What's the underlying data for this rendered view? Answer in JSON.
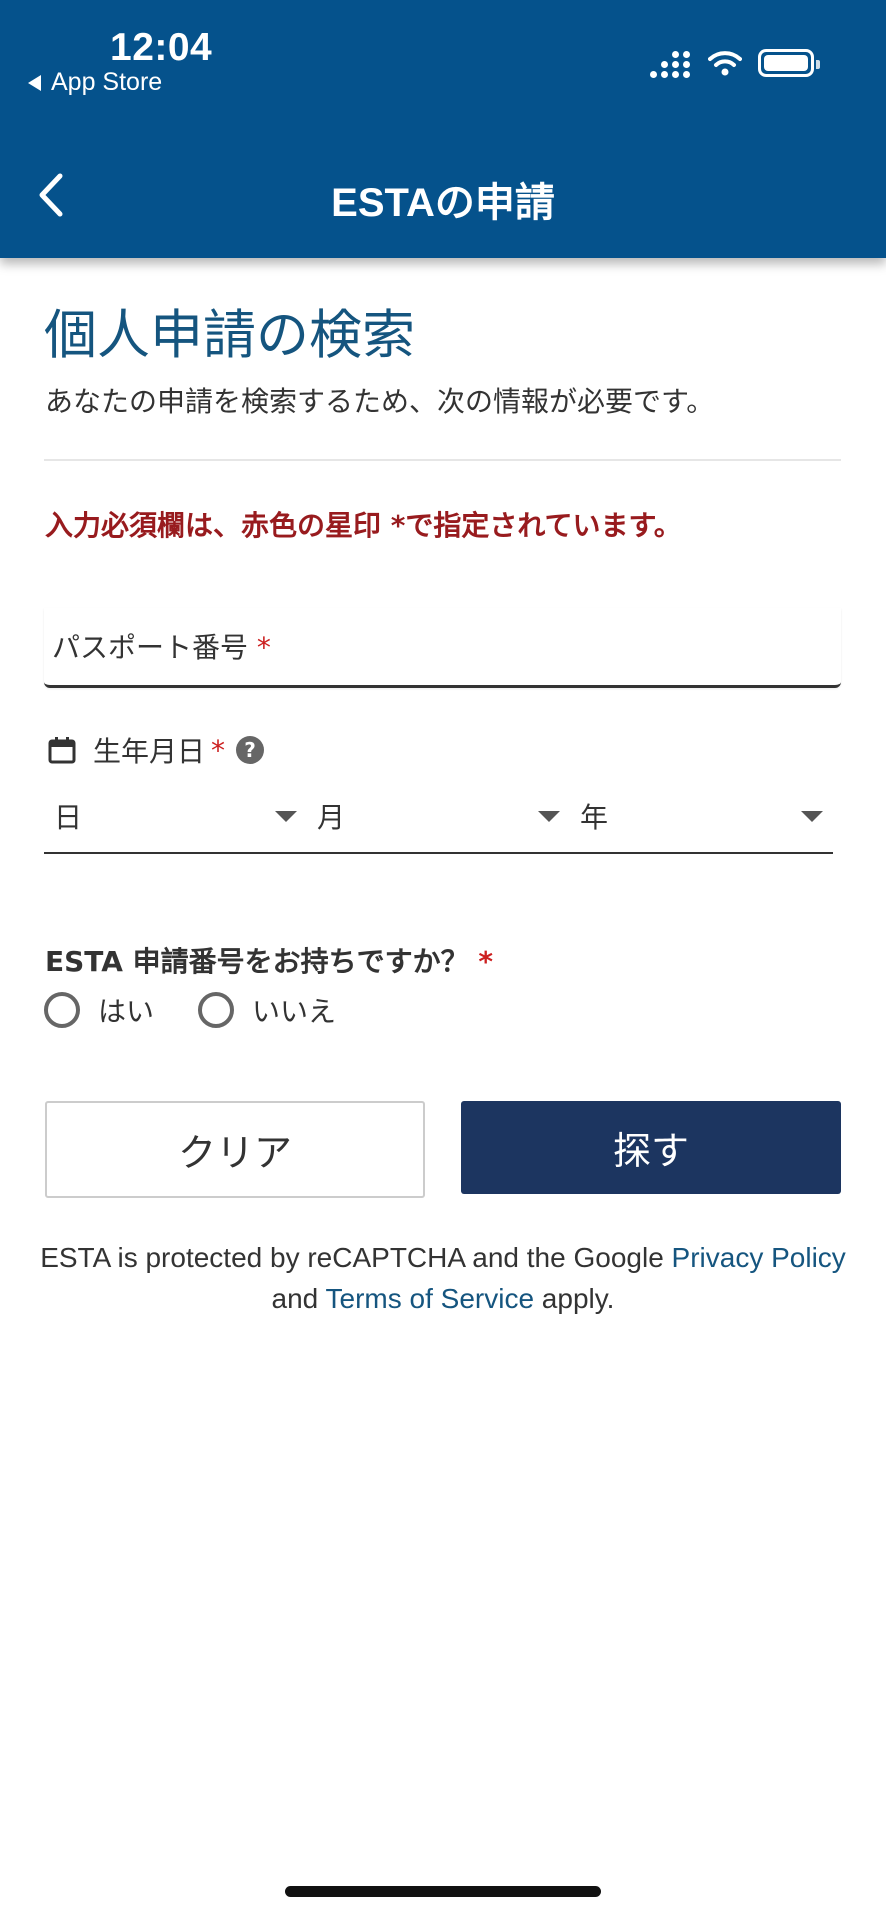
{
  "status_bar": {
    "time": "12:04",
    "back_app": "App Store",
    "icons": [
      "signal-icon",
      "wifi-icon",
      "battery-icon"
    ]
  },
  "nav": {
    "back_icon": "chevron-left-icon",
    "title": "ESTAの申請"
  },
  "main": {
    "title": "個人申請の検索",
    "subtitle": "あなたの申請を検索するため、次の情報が必要です。",
    "required_note": "入力必須欄は、赤色の星印 *で指定されています。",
    "passport": {
      "label": "パスポート番号",
      "required_mark": "*"
    },
    "dob": {
      "label": "生年月日",
      "required_mark": "*",
      "icon": "calendar-icon",
      "help_icon": "help-icon",
      "day": "日",
      "month": "月",
      "year": "年"
    },
    "question": {
      "label": "ESTA 申請番号をお持ちですか？",
      "required_mark": "*"
    },
    "radio": {
      "yes": "はい",
      "no": "いいえ"
    },
    "buttons": {
      "clear": "クリア",
      "search": "探す"
    },
    "recaptcha": {
      "prefix": "ESTA is protected by reCAPTCHA and the Google ",
      "privacy": "Privacy Policy",
      "and": "and ",
      "terms": "Terms of Service",
      "suffix": " apply."
    }
  },
  "colors": {
    "header": "#05528c",
    "title": "#15557f",
    "required": "#981b1e",
    "star": "#cc1f1f",
    "primary_button": "#1c3560",
    "link": "#15557f"
  }
}
